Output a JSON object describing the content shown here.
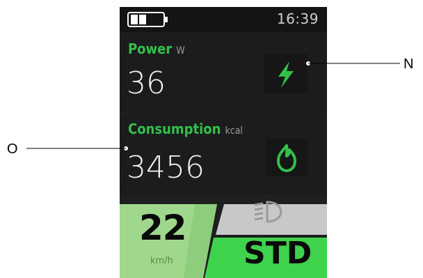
{
  "status_bar": {
    "time": "16:39",
    "battery_bars": 2,
    "battery_total": 4
  },
  "power": {
    "label": "Power",
    "unit": "W",
    "value": "36",
    "icon": "lightning-icon"
  },
  "consumption": {
    "label": "Consumption",
    "unit": "kcal",
    "value": "3456",
    "icon": "flame-icon"
  },
  "speed": {
    "value": "22",
    "unit": "km/h"
  },
  "mode": {
    "label": "STD",
    "headlight_icon": "headlight-icon"
  },
  "callouts": {
    "right": "N",
    "left": "O"
  },
  "colors": {
    "accent_green": "#33c04a",
    "speed_bg": "#9fd88d",
    "mode_bg": "#3ed24d",
    "headlight_bg": "#c7c8c9",
    "screen_bg": "#1e1f20"
  }
}
